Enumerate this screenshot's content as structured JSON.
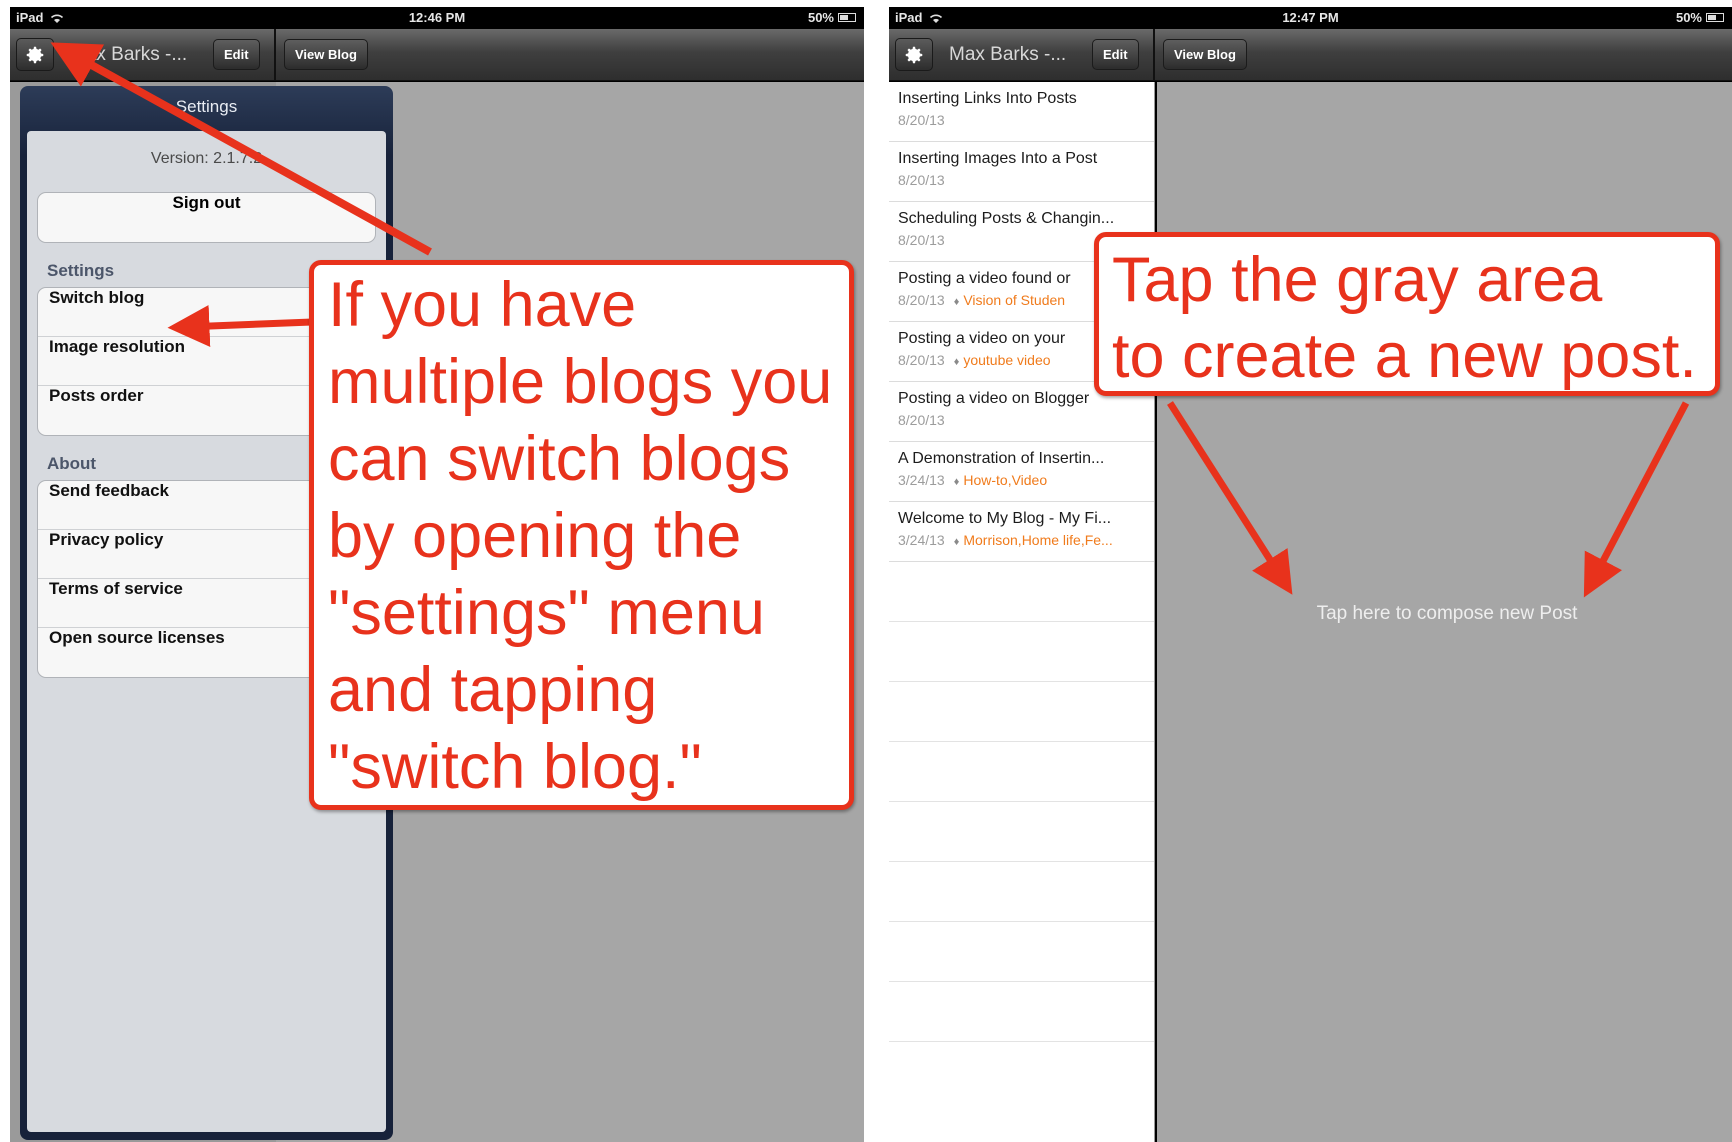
{
  "left_screen": {
    "status_bar": {
      "carrier": "iPad",
      "time": "12:46 PM",
      "battery": "50%"
    },
    "navbar": {
      "blog_title": "Max Barks -...",
      "edit_label": "Edit",
      "view_blog_label": "View Blog"
    },
    "popover": {
      "title": "Settings",
      "version": "Version: 2.1.7.2",
      "sign_out_label": "Sign out",
      "settings_section": {
        "title": "Settings",
        "items": [
          "Switch blog",
          "Image resolution",
          "Posts order"
        ]
      },
      "about_section": {
        "title": "About",
        "items": [
          "Send feedback",
          "Privacy policy",
          "Terms of service",
          "Open source licenses"
        ]
      }
    },
    "callout_text": "If you have multiple blogs you can switch blogs by opening the \"settings\" menu and tapping \"switch blog.\""
  },
  "right_screen": {
    "status_bar": {
      "carrier": "iPad",
      "time": "12:47 PM",
      "battery": "50%"
    },
    "navbar": {
      "blog_title": "Max Barks -...",
      "edit_label": "Edit",
      "view_blog_label": "View Blog"
    },
    "posts": [
      {
        "title": "Inserting Links Into Posts",
        "date": "8/20/13",
        "tags": ""
      },
      {
        "title": "Inserting Images Into a Post",
        "date": "8/20/13",
        "tags": ""
      },
      {
        "title": "Scheduling Posts & Changin...",
        "date": "8/20/13",
        "tags": ""
      },
      {
        "title": "Posting a video found or",
        "date": "8/20/13",
        "tags": "Vision of Studen"
      },
      {
        "title": "Posting a video on your",
        "date": "8/20/13",
        "tags": "youtube video"
      },
      {
        "title": "Posting a video on Blogger",
        "date": "8/20/13",
        "tags": ""
      },
      {
        "title": "A Demonstration of Insertin...",
        "date": "3/24/13",
        "tags": "How-to,Video"
      },
      {
        "title": "Welcome to My Blog - My Fi...",
        "date": "3/24/13",
        "tags": "Morrison,Home life,Fe..."
      }
    ],
    "compose_hint": "Tap here to compose new Post",
    "callout_line1": "Tap the gray area",
    "callout_line2": "to create a new post."
  },
  "colors": {
    "annotation_red": "#e8321c",
    "tag_orange": "#f07b1c",
    "detail_gray": "#a6a6a6",
    "popover_navy": "#17223a"
  },
  "icons": [
    "gear-icon",
    "wifi-icon",
    "battery-icon",
    "tag-icon",
    "arrow-icon"
  ]
}
